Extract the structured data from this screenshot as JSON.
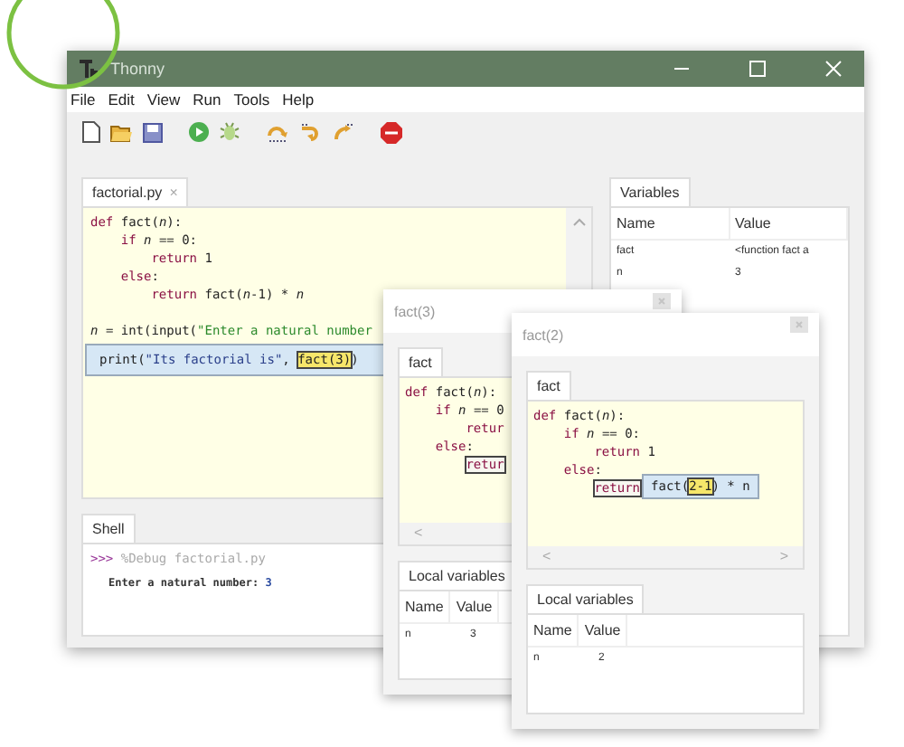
{
  "window": {
    "title": "Thonny"
  },
  "menu": [
    "File",
    "Edit",
    "View",
    "Run",
    "Tools",
    "Help"
  ],
  "editor": {
    "tab": {
      "label": "factorial.py",
      "selected": true
    },
    "close": "×",
    "lines": [
      [
        {
          "text": "def",
          "kind": "kw"
        },
        {
          "text": " fact(",
          "kind": "plain"
        },
        {
          "text": "n",
          "kind": "var"
        },
        {
          "text": "):",
          "kind": "plain"
        }
      ],
      [
        {
          "text": "    if",
          "kind": "kw"
        },
        {
          "text": " n",
          "kind": "var"
        },
        {
          "text": " == 0:",
          "kind": "plain"
        }
      ],
      [
        {
          "text": "        return",
          "kind": "kw"
        },
        {
          "text": " 1",
          "kind": "plain"
        }
      ],
      [
        {
          "text": "    else",
          "kind": "kw"
        },
        {
          "text": ":",
          "kind": "plain"
        }
      ],
      [
        {
          "text": "        return",
          "kind": "kw"
        },
        {
          "text": " fact(",
          "kind": "plain"
        },
        {
          "text": "n",
          "kind": "var"
        },
        {
          "text": "-1) * ",
          "kind": "plain"
        },
        {
          "text": "n",
          "kind": "var"
        }
      ]
    ],
    "input_line": [
      {
        "text": "n",
        "kind": "var"
      },
      {
        "text": " = int(input(",
        "kind": "plain"
      },
      {
        "text": "\"Enter a natural number",
        "kind": "str"
      }
    ],
    "eval_box": [
      {
        "text": "print(",
        "kind": "plain"
      },
      {
        "text": "\"Its factorial is\"",
        "kind": "str2"
      },
      {
        "text": ", ",
        "kind": "plain"
      },
      {
        "text": "fact(3)",
        "kind": "hl"
      },
      {
        "text": ")",
        "kind": "plain"
      }
    ]
  },
  "shell": {
    "tab": {
      "label": "Shell",
      "selected": true
    },
    "lines": [
      [
        {
          "text": ">>> ",
          "kind": "prompt"
        },
        {
          "text": "%Debug factorial.py",
          "kind": "dim"
        }
      ],
      [
        {
          "text": "Enter a natural number: ",
          "kind": "out"
        },
        {
          "text": "3",
          "kind": "blue"
        }
      ]
    ]
  },
  "variables": {
    "tab": {
      "label": "Variables",
      "selected": true
    },
    "columns": [
      "Name",
      "Value"
    ],
    "rows": [
      {
        "name": "fact",
        "value": "<function fact a"
      },
      {
        "name": "n",
        "value": "3"
      }
    ]
  },
  "frames": [
    {
      "title": "fact(3)",
      "tab": {
        "label": "fact",
        "selected": true
      },
      "lines": [
        [
          {
            "text": "def",
            "kind": "kw"
          },
          {
            "text": " fact(",
            "kind": "plain"
          },
          {
            "text": "n",
            "kind": "var"
          },
          {
            "text": "):",
            "kind": "plain"
          }
        ],
        [
          {
            "text": "    if",
            "kind": "kw"
          },
          {
            "text": " n",
            "kind": "var"
          },
          {
            "text": " == 0",
            "kind": "plain"
          }
        ],
        [
          {
            "text": "        retur",
            "kind": "kw"
          }
        ],
        [
          {
            "text": "    else",
            "kind": "kw"
          },
          {
            "text": ":",
            "kind": "plain"
          }
        ],
        [
          {
            "text": "        retur",
            "kind": "boxed"
          }
        ]
      ],
      "scroll_left": "<",
      "locals_tab": {
        "label": "Local variables",
        "selected": true
      },
      "columns": [
        "Name",
        "Value"
      ],
      "rows": [
        {
          "name": "n",
          "value": "3"
        }
      ]
    },
    {
      "title": "fact(2)",
      "tab": {
        "label": "fact",
        "selected": true
      },
      "lines": [
        [
          {
            "text": "def",
            "kind": "kw"
          },
          {
            "text": " fact(",
            "kind": "plain"
          },
          {
            "text": "n",
            "kind": "var"
          },
          {
            "text": "):",
            "kind": "plain"
          }
        ],
        [
          {
            "text": "    if",
            "kind": "kw"
          },
          {
            "text": " n",
            "kind": "var"
          },
          {
            "text": " == 0:",
            "kind": "plain"
          }
        ],
        [
          {
            "text": "        return",
            "kind": "kw"
          },
          {
            "text": " 1",
            "kind": "plain"
          }
        ],
        [
          {
            "text": "    else",
            "kind": "kw"
          },
          {
            "text": ":",
            "kind": "plain"
          }
        ],
        [
          {
            "text": "        return",
            "kind": "boxed"
          }
        ]
      ],
      "popup": [
        {
          "text": "fact(",
          "kind": "plain"
        },
        {
          "text": "2-1",
          "kind": "hl"
        },
        {
          "text": ") * n",
          "kind": "plain"
        }
      ],
      "scroll_left": "<",
      "scroll_right": ">",
      "locals_tab": {
        "label": "Local variables",
        "selected": true
      },
      "columns": [
        "Name",
        "Value"
      ],
      "rows": [
        {
          "name": "n",
          "value": "2"
        }
      ]
    }
  ]
}
